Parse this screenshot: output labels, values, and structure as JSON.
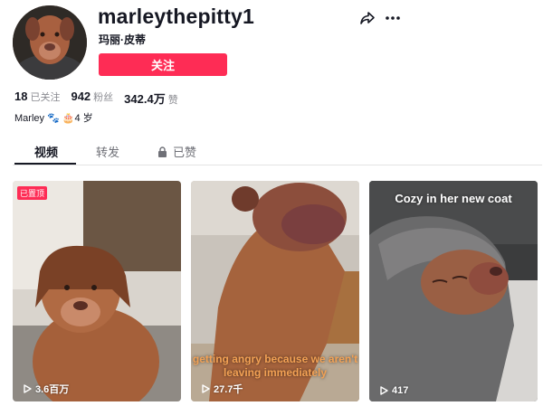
{
  "profile": {
    "username": "marleythepitty1",
    "nickname": "玛丽·皮蒂",
    "follow_label": "关注",
    "bio": "Marley 🐾 🎂4 岁"
  },
  "stats": {
    "following": {
      "value": "18",
      "label": "已关注"
    },
    "followers": {
      "value": "942",
      "label": "粉丝"
    },
    "likes": {
      "value": "342.4万",
      "label": "赞"
    }
  },
  "tabs": [
    {
      "label": "视频"
    },
    {
      "label": "转发"
    },
    {
      "label": "已赞"
    }
  ],
  "videos": [
    {
      "badge": "已置顶",
      "views": "3.6百万"
    },
    {
      "caption": "getting angry because we aren't leaving immediately",
      "views": "27.7千"
    },
    {
      "caption": "Cozy in her new coat",
      "views": "417"
    }
  ],
  "colors": {
    "accent": "#fe2c55",
    "text_primary": "#161823",
    "text_secondary": "#8a8b91",
    "caption_orange": "#f2a154"
  },
  "icons": [
    "share-icon",
    "more-icon",
    "lock-icon",
    "play-icon"
  ]
}
